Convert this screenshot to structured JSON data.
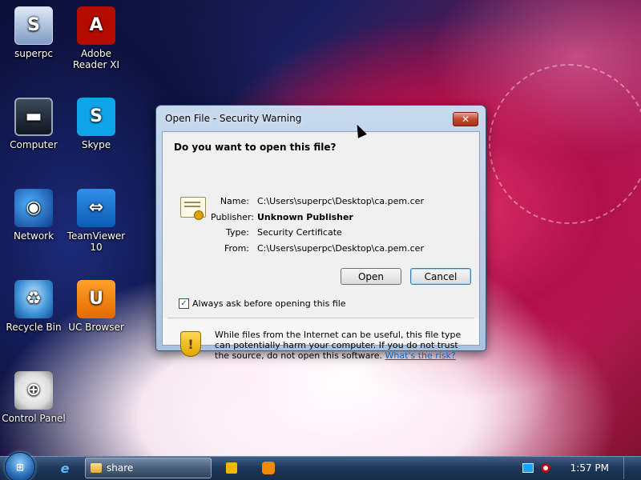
{
  "desktop": {
    "icons": [
      {
        "label": "superpc",
        "icon": "user-folder-icon",
        "glyph": "S"
      },
      {
        "label": "Adobe Reader XI",
        "icon": "adobe-reader-icon",
        "glyph": "A"
      },
      {
        "label": "Computer",
        "icon": "computer-icon",
        "glyph": "▬"
      },
      {
        "label": "Skype",
        "icon": "skype-icon",
        "glyph": "S"
      },
      {
        "label": "Network",
        "icon": "network-icon",
        "glyph": "◉"
      },
      {
        "label": "TeamViewer 10",
        "icon": "teamviewer-icon",
        "glyph": "⇔"
      },
      {
        "label": "Recycle Bin",
        "icon": "recycle-bin-icon",
        "glyph": "♻"
      },
      {
        "label": "UC Browser",
        "icon": "uc-browser-icon",
        "glyph": "U"
      },
      {
        "label": "Control Panel",
        "icon": "control-panel-icon",
        "glyph": "⊕"
      }
    ]
  },
  "dialog": {
    "title": "Open File - Security Warning",
    "close_glyph": "✕",
    "question": "Do you want to open this file?",
    "fields": [
      {
        "key": "Name:",
        "value": "C:\\Users\\superpc\\Desktop\\ca.pem.cer"
      },
      {
        "key": "Publisher:",
        "value": "Unknown Publisher"
      },
      {
        "key": "Type:",
        "value": "Security Certificate"
      },
      {
        "key": "From:",
        "value": "C:\\Users\\superpc\\Desktop\\ca.pem.cer"
      }
    ],
    "open_label": "Open",
    "cancel_label": "Cancel",
    "checkbox_label": "Always ask before opening this file",
    "checkbox_checked": true,
    "warning_text": "While files from the Internet can be useful, this file type can potentially harm your computer. If you do not trust the source, do not open this software.",
    "warning_link": "What's the risk?"
  },
  "taskbar": {
    "start_glyph": "⊞",
    "ie_glyph": "e",
    "task_label": "share",
    "clock": "1:57 PM"
  },
  "colors": {
    "taskbar": "#1d3657",
    "dialog_frame": "#a9c2df",
    "link": "#0066cc",
    "close_button": "#c24a2d"
  }
}
